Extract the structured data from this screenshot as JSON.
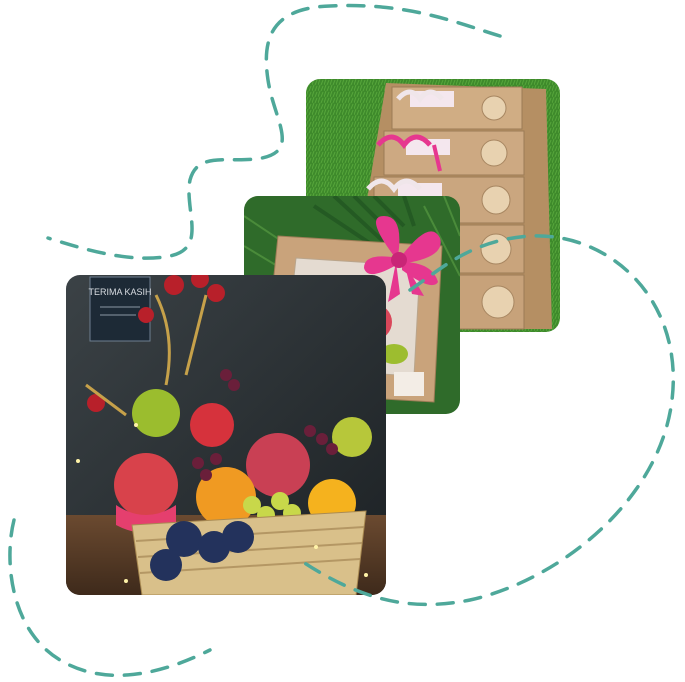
{
  "images": {
    "boxes": {
      "name": "kraft-gift-boxes-photo",
      "alt": ""
    },
    "gift": {
      "name": "fruit-gift-box-photo",
      "alt": ""
    },
    "basket": {
      "name": "fruit-basket-photo",
      "alt": ""
    }
  },
  "sign": {
    "title": "TERIMA KASIH"
  },
  "colors": {
    "dash": "#4ea89a",
    "grass": "#3f8a2c",
    "kraft": "#c8a27a",
    "ribbon": "#e6378f",
    "background": "#ffffff"
  }
}
